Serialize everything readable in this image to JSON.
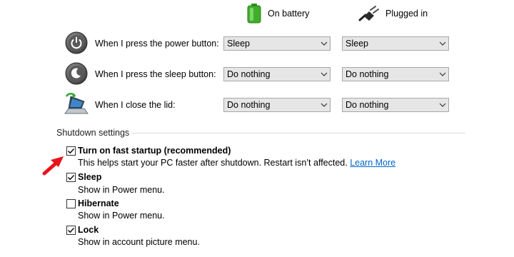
{
  "columns": {
    "battery": {
      "label": "On battery",
      "icon": "battery-icon"
    },
    "plugged": {
      "label": "Plugged in",
      "icon": "power-plug-icon"
    }
  },
  "rows": [
    {
      "label": "When I press the power button:",
      "icon": "power-button-icon",
      "battery": "Sleep",
      "plugged": "Sleep"
    },
    {
      "label": "When I press the sleep button:",
      "icon": "sleep-button-icon",
      "battery": "Do nothing",
      "plugged": "Do nothing"
    },
    {
      "label": "When I close the lid:",
      "icon": "laptop-lid-icon",
      "battery": "Do nothing",
      "plugged": "Do nothing"
    }
  ],
  "shutdown": {
    "title": "Shutdown settings",
    "options": [
      {
        "label": "Turn on fast startup (recommended)",
        "desc": "This helps start your PC faster after shutdown. Restart isn’t affected.",
        "link": "Learn More",
        "checked": true
      },
      {
        "label": "Sleep",
        "desc": "Show in Power menu.",
        "checked": true
      },
      {
        "label": "Hibernate",
        "desc": "Show in Power menu.",
        "checked": false
      },
      {
        "label": "Lock",
        "desc": "Show in account picture menu.",
        "checked": true
      }
    ]
  },
  "annotation": {
    "icon": "red-arrow-icon",
    "color": "#e8141b"
  },
  "colors": {
    "accent_link": "#0066cc",
    "battery_green": "#3fae2a",
    "dropdown_bg": "#e6e6e6"
  }
}
